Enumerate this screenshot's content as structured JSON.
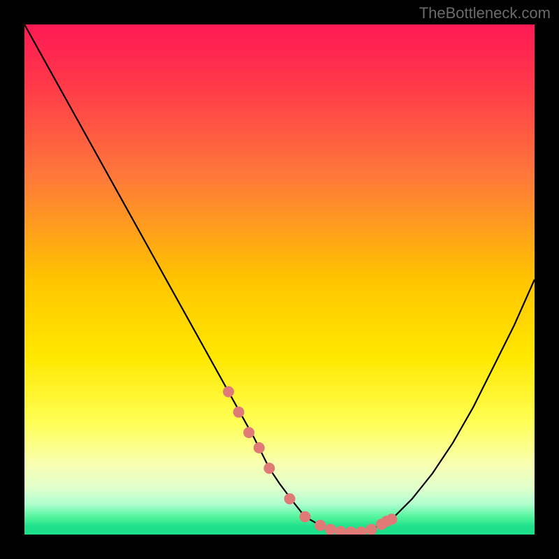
{
  "watermark": "TheBottleneck.com",
  "chart_data": {
    "type": "line",
    "title": "",
    "xlabel": "",
    "ylabel": "",
    "xlim": [
      0,
      100
    ],
    "ylim": [
      0,
      100
    ],
    "series": [
      {
        "name": "curve",
        "x": [
          0,
          5,
          10,
          15,
          20,
          25,
          30,
          35,
          40,
          45,
          48,
          50,
          53,
          55,
          58,
          60,
          63,
          65,
          68,
          72,
          76,
          80,
          84,
          88,
          92,
          96,
          100
        ],
        "y": [
          100,
          91,
          82,
          73,
          64,
          55,
          46,
          37,
          28,
          19,
          13,
          10,
          6,
          3.5,
          1.8,
          1.0,
          0.5,
          0.5,
          1.0,
          3,
          7,
          12,
          18,
          25,
          33,
          41,
          50
        ]
      }
    ],
    "highlight_points": {
      "x": [
        40,
        42,
        44,
        46,
        48,
        52,
        55,
        58,
        60,
        62,
        64,
        66,
        68,
        70,
        71,
        72
      ],
      "y": [
        28,
        24,
        20,
        17,
        13,
        7,
        3.5,
        1.8,
        1.0,
        0.6,
        0.5,
        0.5,
        1.0,
        2.0,
        2.6,
        3
      ]
    },
    "gradient_stops": [
      {
        "offset": 0.0,
        "color": "#ff1a55"
      },
      {
        "offset": 0.12,
        "color": "#ff3a4a"
      },
      {
        "offset": 0.3,
        "color": "#ff7a3a"
      },
      {
        "offset": 0.5,
        "color": "#ffc500"
      },
      {
        "offset": 0.65,
        "color": "#ffe800"
      },
      {
        "offset": 0.78,
        "color": "#ffff55"
      },
      {
        "offset": 0.86,
        "color": "#f9ffb0"
      },
      {
        "offset": 0.91,
        "color": "#e0ffce"
      },
      {
        "offset": 0.94,
        "color": "#b0ffd0"
      },
      {
        "offset": 0.965,
        "color": "#55f59e"
      },
      {
        "offset": 0.985,
        "color": "#1ee08a"
      },
      {
        "offset": 1.0,
        "color": "#1ee08a"
      }
    ]
  }
}
